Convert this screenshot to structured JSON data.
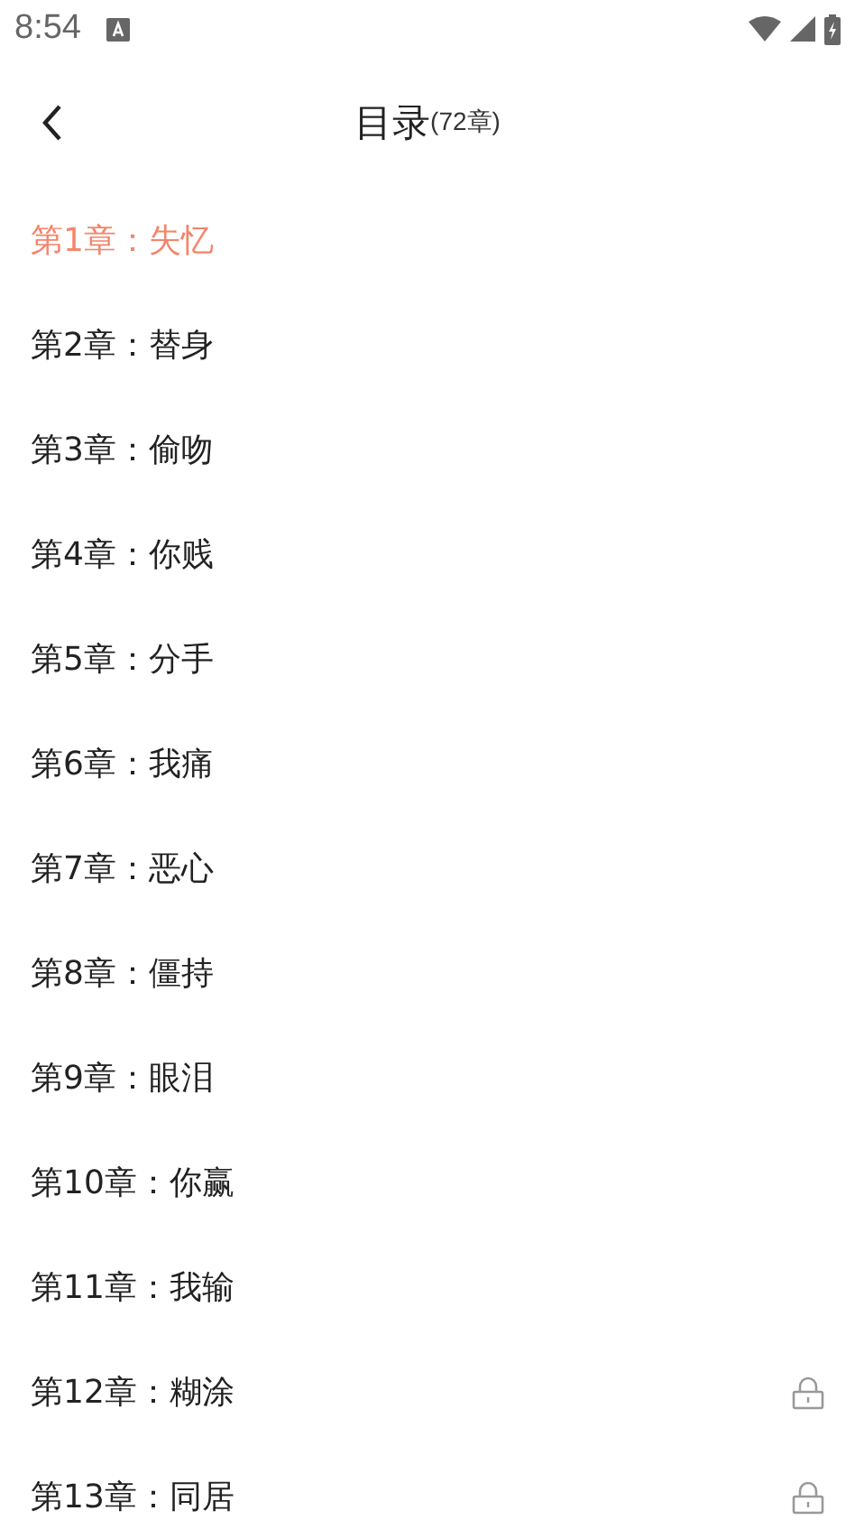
{
  "status_bar": {
    "time": "8:54"
  },
  "header": {
    "title": "目录",
    "count": "(72章)"
  },
  "chapters": [
    {
      "title": "第1章：失忆",
      "selected": true,
      "locked": false
    },
    {
      "title": "第2章：替身",
      "selected": false,
      "locked": false
    },
    {
      "title": "第3章：偷吻",
      "selected": false,
      "locked": false
    },
    {
      "title": "第4章：你贱",
      "selected": false,
      "locked": false
    },
    {
      "title": "第5章：分手",
      "selected": false,
      "locked": false
    },
    {
      "title": "第6章：我痛",
      "selected": false,
      "locked": false
    },
    {
      "title": "第7章：恶心",
      "selected": false,
      "locked": false
    },
    {
      "title": "第8章：僵持",
      "selected": false,
      "locked": false
    },
    {
      "title": "第9章：眼泪",
      "selected": false,
      "locked": false
    },
    {
      "title": "第10章：你赢",
      "selected": false,
      "locked": false
    },
    {
      "title": "第11章：我输",
      "selected": false,
      "locked": false
    },
    {
      "title": "第12章：糊涂",
      "selected": false,
      "locked": true
    },
    {
      "title": "第13章：同居",
      "selected": false,
      "locked": true
    }
  ]
}
